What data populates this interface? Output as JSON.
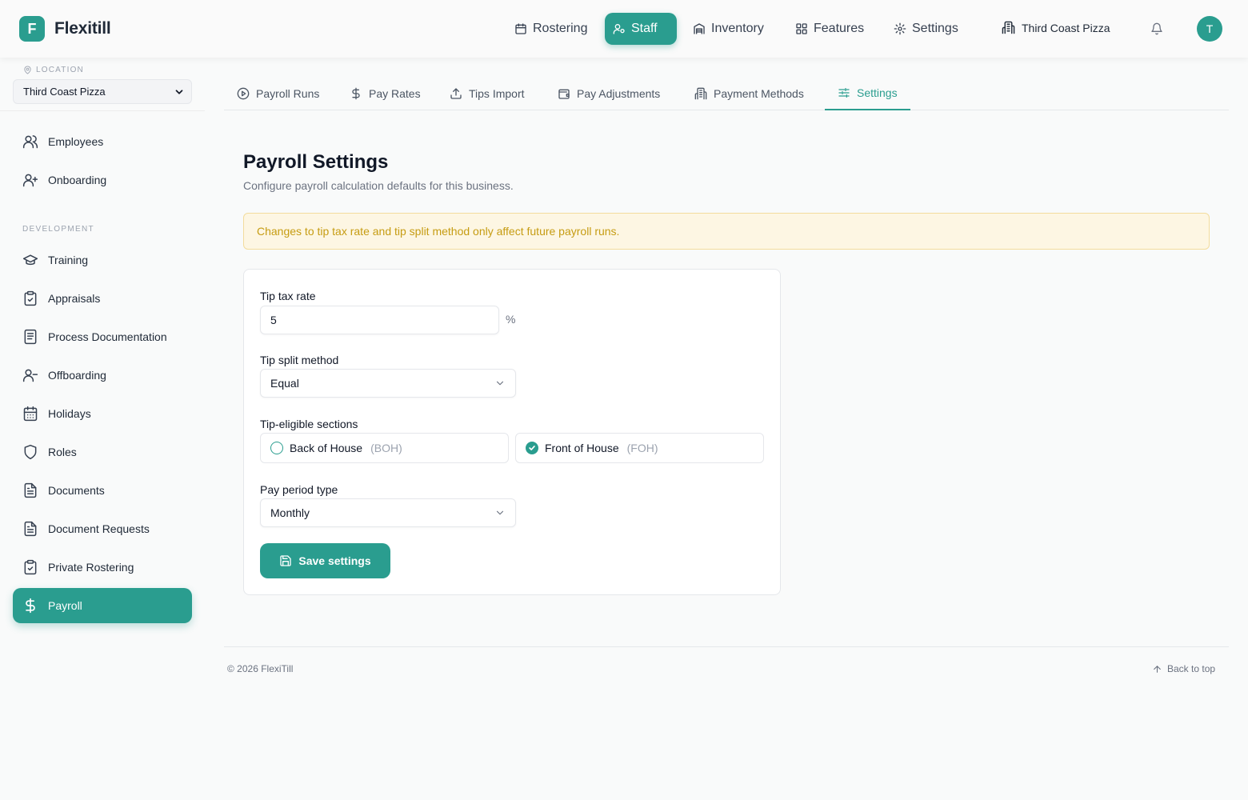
{
  "app": {
    "logo_letter": "F",
    "name": "Flexitill",
    "business": "Third Coast Pizza",
    "avatar_initial": "T"
  },
  "topnav": {
    "rostering": "Rostering",
    "staff": "Staff",
    "inventory": "Inventory",
    "features": "Features",
    "settings": "Settings"
  },
  "sidebar": {
    "location_label": "LOCATION",
    "location_value": "Third Coast Pizza",
    "section_development": "DEVELOPMENT",
    "items": {
      "employees": "Employees",
      "onboarding": "Onboarding",
      "training": "Training",
      "appraisals": "Appraisals",
      "process_documentation": "Process Documentation",
      "offboarding": "Offboarding",
      "holidays": "Holidays",
      "roles": "Roles",
      "documents": "Documents",
      "document_requests": "Document Requests",
      "private_rostering": "Private Rostering",
      "payroll": "Payroll"
    }
  },
  "tabs": {
    "payroll_runs": "Payroll Runs",
    "pay_rates": "Pay Rates",
    "tips_import": "Tips Import",
    "pay_adjustments": "Pay Adjustments",
    "payment_methods": "Payment Methods",
    "settings": "Settings"
  },
  "main": {
    "title": "Payroll Settings",
    "subtitle": "Configure payroll calculation defaults for this business.",
    "banner": "Changes to tip tax rate and tip split method only affect future payroll runs.",
    "tip_tax_label": "Tip tax rate",
    "tip_tax_value": "5",
    "tip_tax_unit": "%",
    "tip_split_label": "Tip split method",
    "tip_split_value": "Equal",
    "sections_label": "Tip-eligible sections",
    "boh_label": "Back of House",
    "boh_abbr": "(BOH)",
    "foh_label": "Front of House",
    "foh_abbr": "(FOH)",
    "pay_period_label": "Pay period type",
    "pay_period_value": "Monthly",
    "save_label": "Save settings"
  },
  "footer": {
    "copyright": "© 2026 FlexiTill",
    "back_to_top": "Back to top"
  },
  "colors": {
    "accent": "#2a9d8f",
    "banner_bg": "#fdf6e3",
    "banner_text": "#c69c12"
  }
}
